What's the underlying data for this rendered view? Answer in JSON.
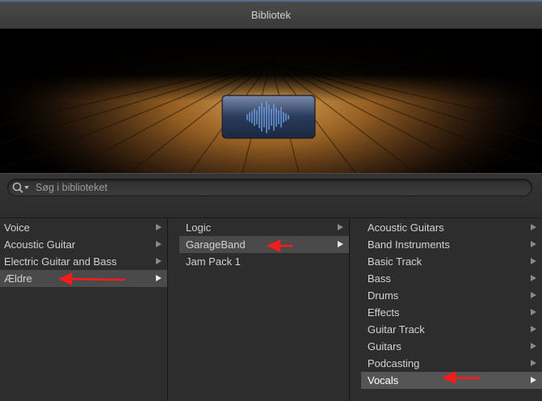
{
  "window": {
    "title": "Bibliotek"
  },
  "preview": {
    "icon": "waveform-icon"
  },
  "search": {
    "placeholder": "Søg i biblioteket",
    "value": ""
  },
  "columns": {
    "col1": [
      {
        "label": "Voice"
      },
      {
        "label": "Acoustic Guitar"
      },
      {
        "label": "Electric Guitar and Bass"
      },
      {
        "label": "Ældre",
        "selected": true
      }
    ],
    "col2": [
      {
        "label": "Logic"
      },
      {
        "label": "GarageBand",
        "selected": true
      },
      {
        "label": "Jam Pack 1"
      }
    ],
    "col3": [
      {
        "label": "Acoustic Guitars"
      },
      {
        "label": "Band Instruments"
      },
      {
        "label": "Basic Track"
      },
      {
        "label": "Bass"
      },
      {
        "label": "Drums"
      },
      {
        "label": "Effects"
      },
      {
        "label": "Guitar Track"
      },
      {
        "label": "Guitars"
      },
      {
        "label": "Podcasting"
      },
      {
        "label": "Vocals",
        "selected": true
      }
    ]
  },
  "colors": {
    "accent_arrow": "#ff1a1a",
    "floor_light": "#c98a3a",
    "icon_blue": "#5b8fd6"
  }
}
